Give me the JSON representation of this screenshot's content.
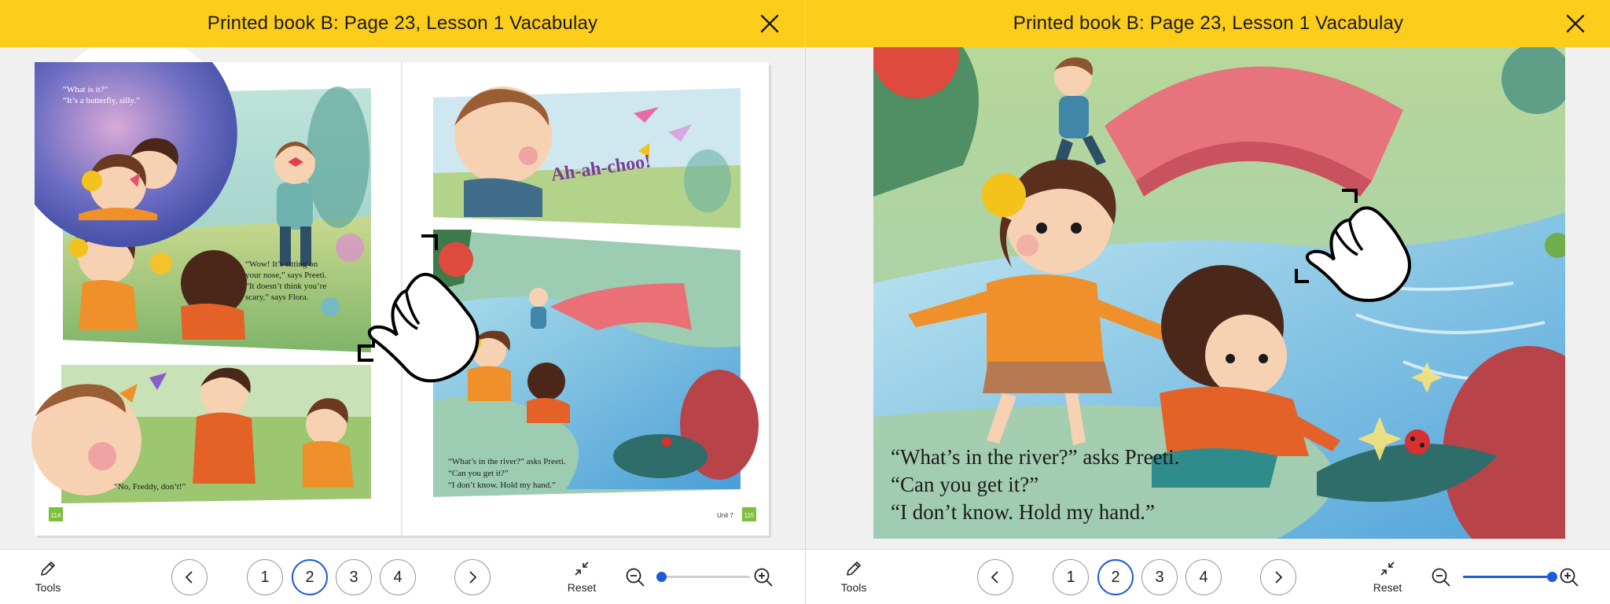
{
  "left_pane": {
    "title": "Printed book B: Page 23, Lesson 1 Vacabulay",
    "book": {
      "panel1_caption": [
        "“What is it?”",
        "“It’s a butterfly, silly.”"
      ],
      "panel2_caption": [
        "“Wow! It’s sitting on",
        "your nose,” says Preeti.",
        "“It doesn’t think you’re",
        "scary,” says Flora."
      ],
      "panel3_sound": "Ah-ah-choo!",
      "panel4_caption": "“No, Freddy, don’t!”",
      "panel5_caption": [
        "“What’s in the river?” asks Preeti.",
        "“Can you get it?”",
        "“I don’t know. Hold my hand.”"
      ],
      "left_page_number": "114",
      "right_page_number": "115",
      "unit_label": "Unit 7"
    },
    "toolbar": {
      "tools_label": "Tools",
      "pages": [
        "1",
        "2",
        "3",
        "4"
      ],
      "active_page": "2",
      "reset_label": "Reset",
      "zoom_level": 0.0
    }
  },
  "right_pane": {
    "title": "Printed book B: Page 23, Lesson 1 Vacabulay",
    "zoomed_caption": [
      "“What’s in the river?” asks Preeti.",
      "“Can you get it?”",
      "“I don’t know. Hold my hand.”"
    ],
    "toolbar": {
      "tools_label": "Tools",
      "pages": [
        "1",
        "2",
        "3",
        "4"
      ],
      "active_page": "2",
      "reset_label": "Reset",
      "zoom_level": 1.0
    }
  },
  "colors": {
    "header": "#fccd1b",
    "accent": "#1e5bd8",
    "page_badge": "#7cbf3b"
  },
  "icons": {
    "close": "close-icon",
    "gesture": "pinch-hand-icon",
    "tools": "pencil-icon",
    "prev": "chevron-left-icon",
    "next": "chevron-right-icon",
    "reset": "collapse-arrows-icon",
    "zoom_out": "zoom-out-icon",
    "zoom_in": "zoom-in-icon"
  }
}
